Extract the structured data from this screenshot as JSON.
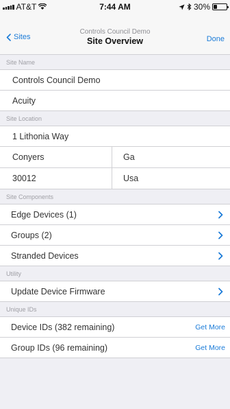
{
  "status_bar": {
    "carrier": "AT&T",
    "time": "7:44 AM",
    "battery": "30%",
    "battery_level": 0.3
  },
  "nav": {
    "back_label": "Sites",
    "subtitle": "Controls Council Demo",
    "title": "Site Overview",
    "done_label": "Done"
  },
  "site_name": {
    "header": "Site Name",
    "name": "Controls Council Demo",
    "company": "Acuity"
  },
  "site_location": {
    "header": "Site Location",
    "address": "1 Lithonia Way",
    "city": "Conyers",
    "state": "Ga",
    "zip": "30012",
    "country": "Usa"
  },
  "components": {
    "header": "Site Components",
    "edge_devices": "Edge Devices (1)",
    "groups": "Groups (2)",
    "stranded_devices": "Stranded Devices"
  },
  "utility": {
    "header": "Utility",
    "update_firmware": "Update Device Firmware"
  },
  "unique_ids": {
    "header": "Unique IDs",
    "device_ids": "Device IDs (382 remaining)",
    "group_ids": "Group IDs (96 remaining)",
    "get_more_label": "Get More"
  },
  "colors": {
    "accent": "#1a7bd8",
    "background": "#efeff4"
  }
}
